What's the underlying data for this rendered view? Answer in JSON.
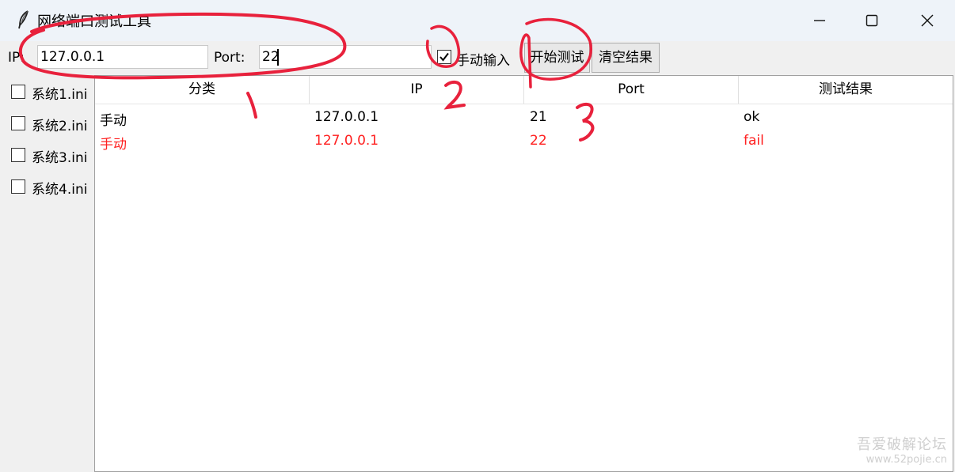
{
  "window": {
    "title": "网络端口测试工具",
    "icon": "feather-icon",
    "controls": [
      "minimize-icon",
      "maximize-icon",
      "close-icon"
    ]
  },
  "toolbar": {
    "ip_label": "IP:",
    "ip_value": "127.0.0.1",
    "port_label": "Port:",
    "port_value": "22",
    "manual_checkbox": {
      "label": "手动输入",
      "checked": true
    },
    "start_label": "开始测试",
    "clear_label": "清空结果"
  },
  "sidebar": {
    "items": [
      {
        "label": "系统1.ini",
        "checked": false
      },
      {
        "label": "系统2.ini",
        "checked": false
      },
      {
        "label": "系统3.ini",
        "checked": false
      },
      {
        "label": "系统4.ini",
        "checked": false
      }
    ]
  },
  "table": {
    "columns": [
      "分类",
      "IP",
      "Port",
      "测试结果"
    ],
    "rows": [
      {
        "category": "手动",
        "ip": "127.0.0.1",
        "port": "21",
        "result": "ok",
        "status": "ok"
      },
      {
        "category": "手动",
        "ip": "127.0.0.1",
        "port": "22",
        "result": "fail",
        "status": "fail"
      }
    ]
  },
  "annotations": [
    "1",
    "2",
    "3"
  ],
  "watermark": {
    "line1": "吾爱破解论坛",
    "line2": "www.52pojie.cn"
  },
  "colors": {
    "fail": "#ff2020",
    "annotation": "#e8213c",
    "titlebar": "#eef3f9"
  }
}
